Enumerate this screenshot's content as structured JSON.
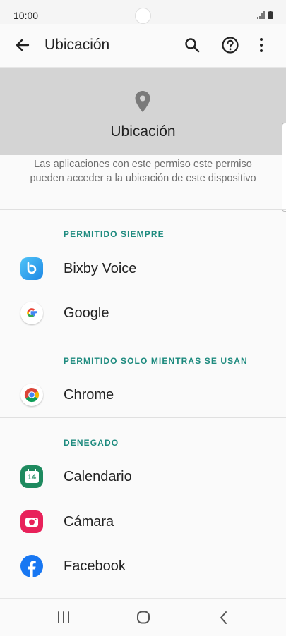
{
  "status_bar": {
    "time": "10:00"
  },
  "app_bar": {
    "title": "Ubicación"
  },
  "hero": {
    "title": "Ubicación"
  },
  "description": "Las aplicaciones con este permiso este permiso pueden acceder a la ubicación de este dispositivo",
  "sections": [
    {
      "header": "PERMITIDO SIEMPRE",
      "apps": [
        "Bixby Voice",
        "Google"
      ]
    },
    {
      "header": "PERMITIDO SOLO MIENTRAS SE USAN",
      "apps": [
        "Chrome"
      ]
    },
    {
      "header": "DENEGADO",
      "apps": [
        "Calendario",
        "Cámara",
        "Facebook"
      ]
    }
  ],
  "calendar_icon_text": "14",
  "colors": {
    "accent": "#1d8a7e",
    "bixby": "#1e88e5",
    "calendar": "#1e8a5f",
    "camera": "#e8215a",
    "facebook": "#1877f2"
  }
}
